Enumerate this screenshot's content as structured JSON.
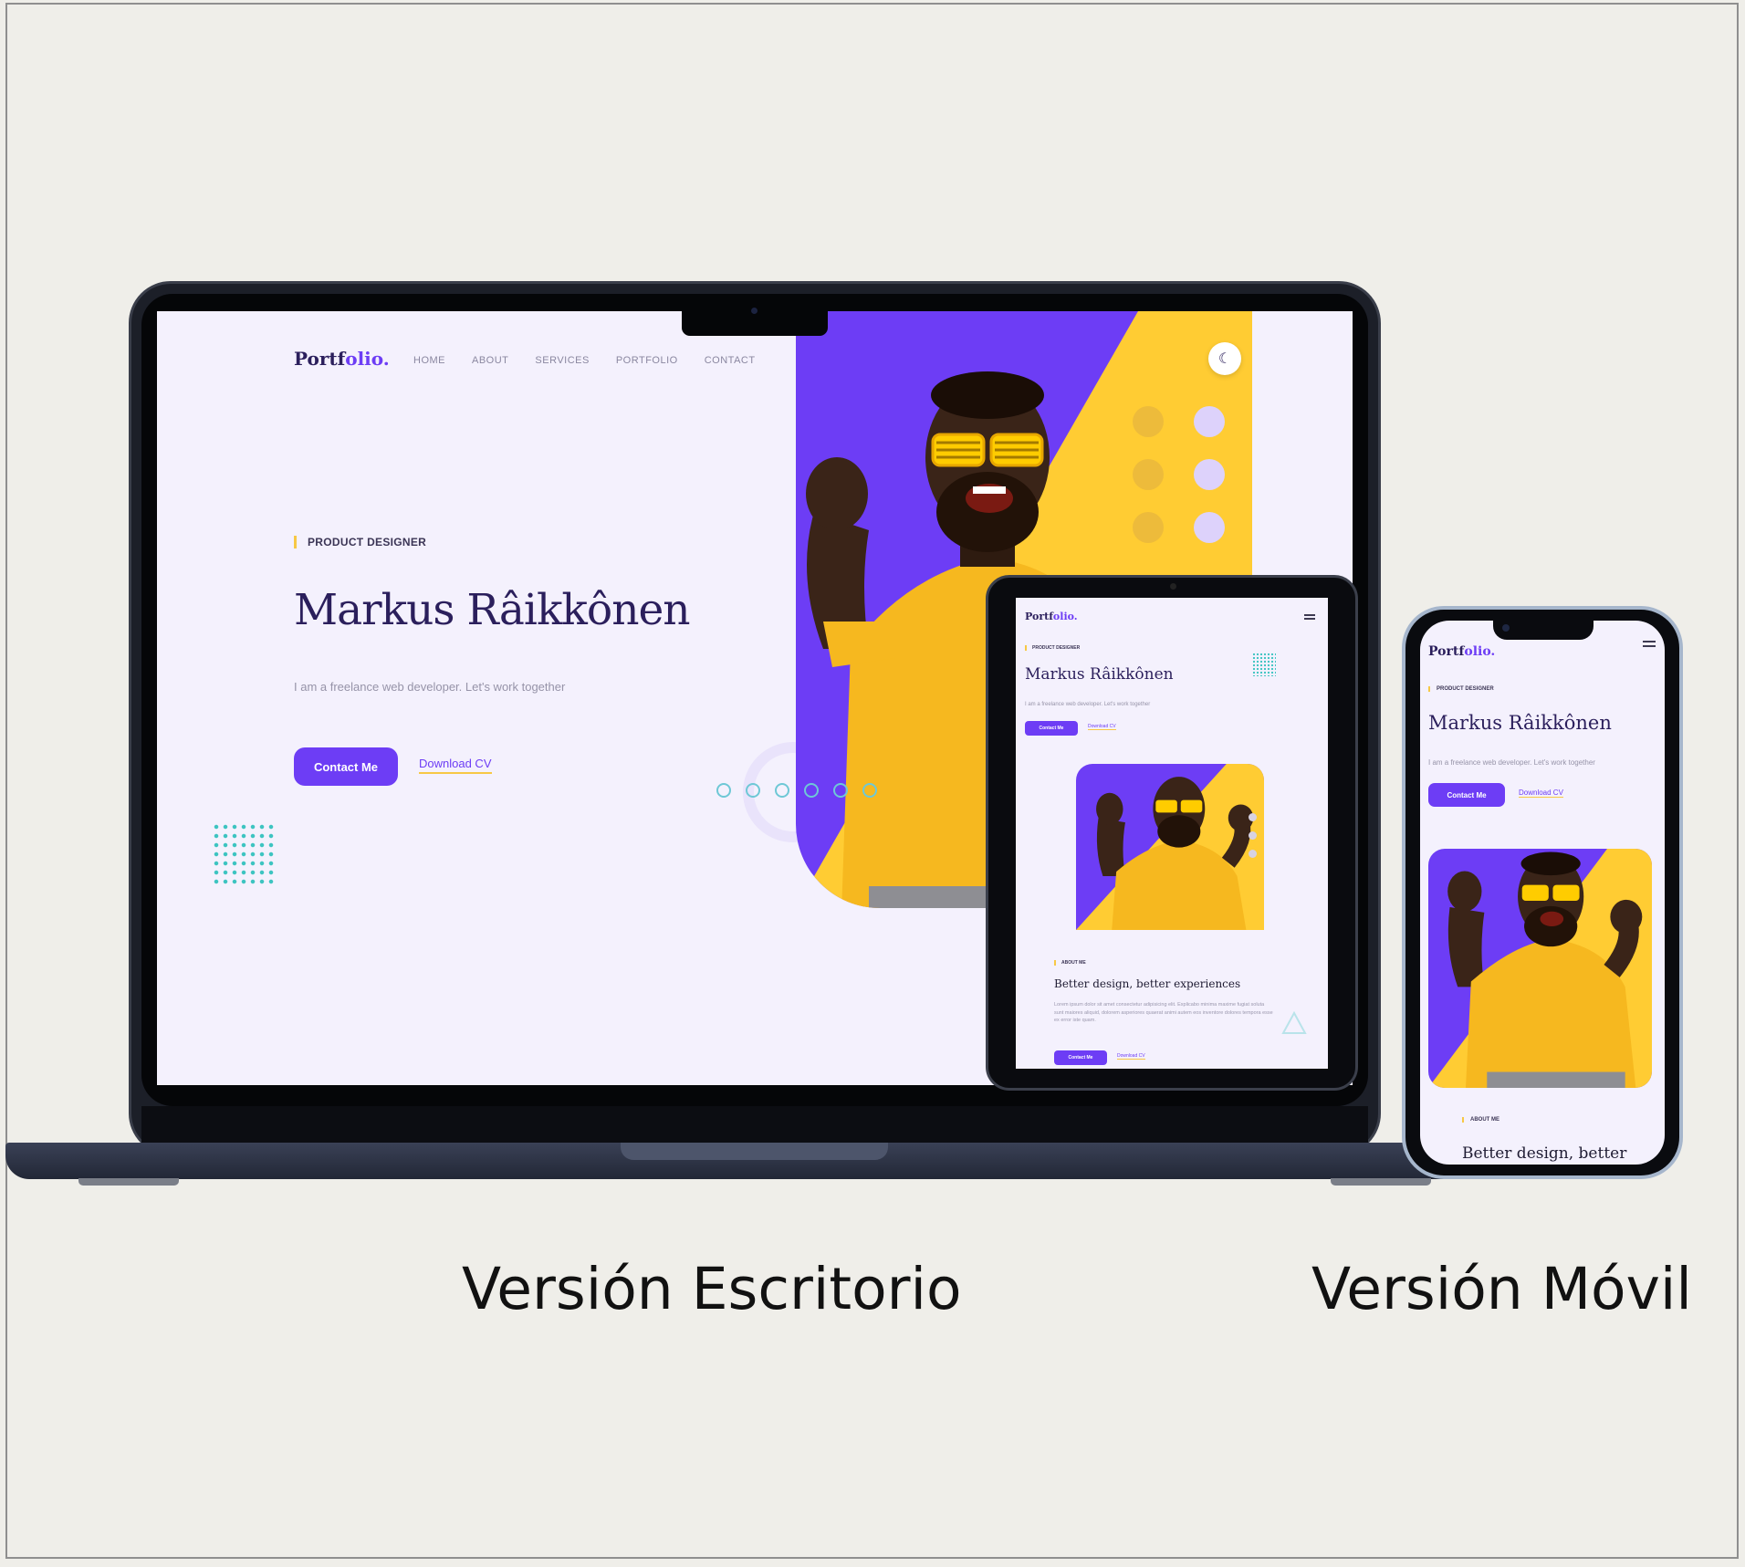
{
  "desktop": {
    "logo_main": "Portf",
    "logo_accent": "olio.",
    "nav": [
      "HOME",
      "ABOUT",
      "SERVICES",
      "PORTFOLIO",
      "CONTACT"
    ],
    "tagline": "PRODUCT DESIGNER",
    "name": "Markus Râikkônen",
    "description": "I am a freelance web developer. Let's work together",
    "primary_button": "Contact Me",
    "secondary_link": "Download CV",
    "theme_icon": "moon-icon"
  },
  "tablet": {
    "logo_main": "Portf",
    "logo_accent": "olio.",
    "tagline": "PRODUCT DESIGNER",
    "name": "Markus Râikkônen",
    "description": "I am a freelance web developer. Let's work together",
    "primary_button": "Contact Me",
    "secondary_link": "Download CV",
    "about_tag": "ABOUT ME",
    "about_heading": "Better design, better experiences",
    "about_text": "Lorem ipsum dolor sit amet consectetur adipisicing elit. Explicabo minima maxime fugiat soluta sunt maiores aliquid, dolorem asperiores quaerat animi autem eos inventore dolores tempora esse ex error iste quam.",
    "about_button": "Contact Me",
    "about_link": "Download CV"
  },
  "mobile": {
    "logo_main": "Portf",
    "logo_accent": "olio.",
    "tagline": "PRODUCT DESIGNER",
    "name": "Markus Râikkônen",
    "description": "I am a freelance web developer. Let's work together",
    "primary_button": "Contact Me",
    "secondary_link": "Download CV",
    "about_tag": "ABOUT ME",
    "about_heading": "Better design, better"
  },
  "captions": {
    "desktop": "Versión Escritorio",
    "mobile": "Versión Móvil"
  },
  "colors": {
    "brand_purple": "#6d3df5",
    "brand_yellow": "#ffcc33",
    "page_bg": "#f4f1fd",
    "teal_accent": "#3dc4c1"
  }
}
